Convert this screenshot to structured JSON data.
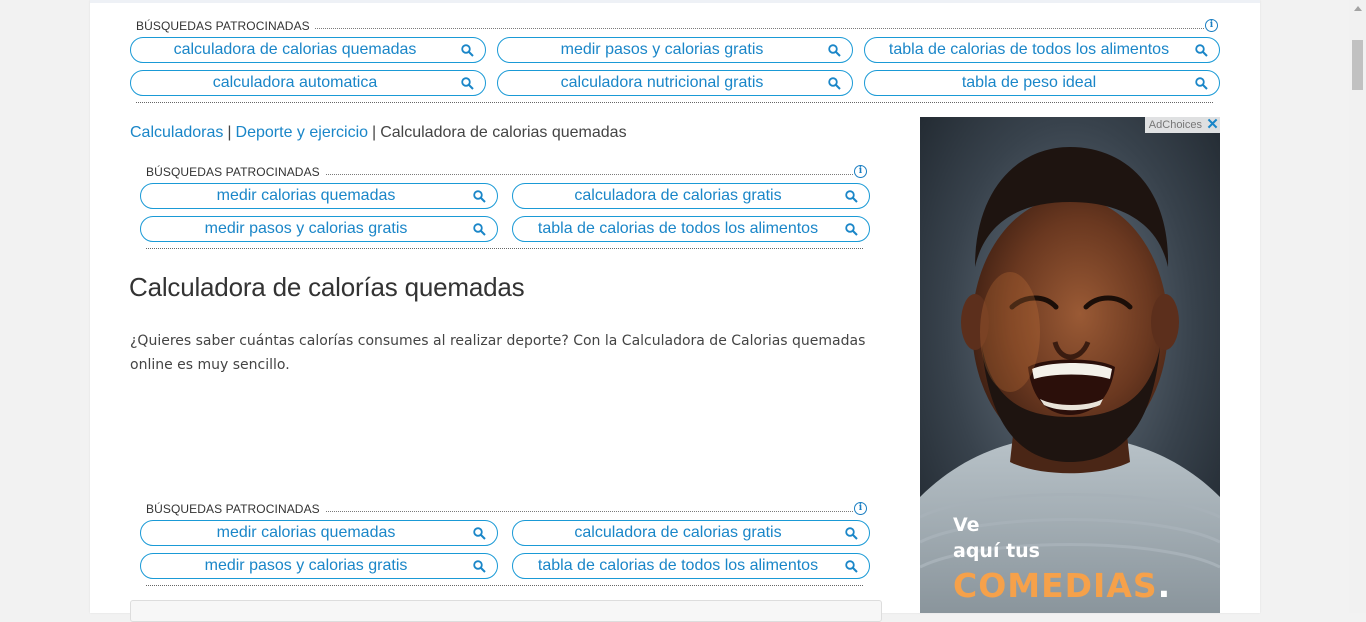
{
  "sponsored_top": {
    "heading": "BÚSQUEDAS PATROCINADAS",
    "items": [
      "calculadora de calorias quemadas",
      "medir pasos y calorias gratis",
      "tabla de calorias de todos los alimentos",
      "calculadora automatica",
      "calculadora nutricional gratis",
      "tabla de peso ideal"
    ]
  },
  "breadcrumb": {
    "items": [
      "Calculadoras",
      "Deporte y ejercicio"
    ],
    "separator": "|",
    "current": "Calculadora de calorias quemadas"
  },
  "sponsored_mid": {
    "heading": "BÚSQUEDAS PATROCINADAS",
    "items": [
      "medir calorias quemadas",
      "calculadora de calorias gratis",
      "medir pasos y calorias gratis",
      "tabla de calorias de todos los alimentos"
    ]
  },
  "main": {
    "title": "Calculadora de calorías quemadas",
    "intro": "¿Quieres saber cuántas calorías consumes al realizar deporte? Con la Calculadora de Calorias quemadas online es muy sencillo."
  },
  "sponsored_bottom": {
    "heading": "BÚSQUEDAS PATROCINADAS",
    "items": [
      "medir calorias quemadas",
      "calculadora de calorias gratis",
      "medir pasos y calorias gratis",
      "tabla de calorias de todos los alimentos"
    ]
  },
  "ad": {
    "adchoices_label": "AdChoices",
    "close_glyph": "✕",
    "line1": "Ve",
    "line2": "aquí tus",
    "line3": "COMEDIAS",
    "line3_dot": ".",
    "accent_color": "#f6a14a"
  },
  "colors": {
    "link": "#1a86c8",
    "pill_border": "#1a9ad6",
    "text": "#333333"
  }
}
